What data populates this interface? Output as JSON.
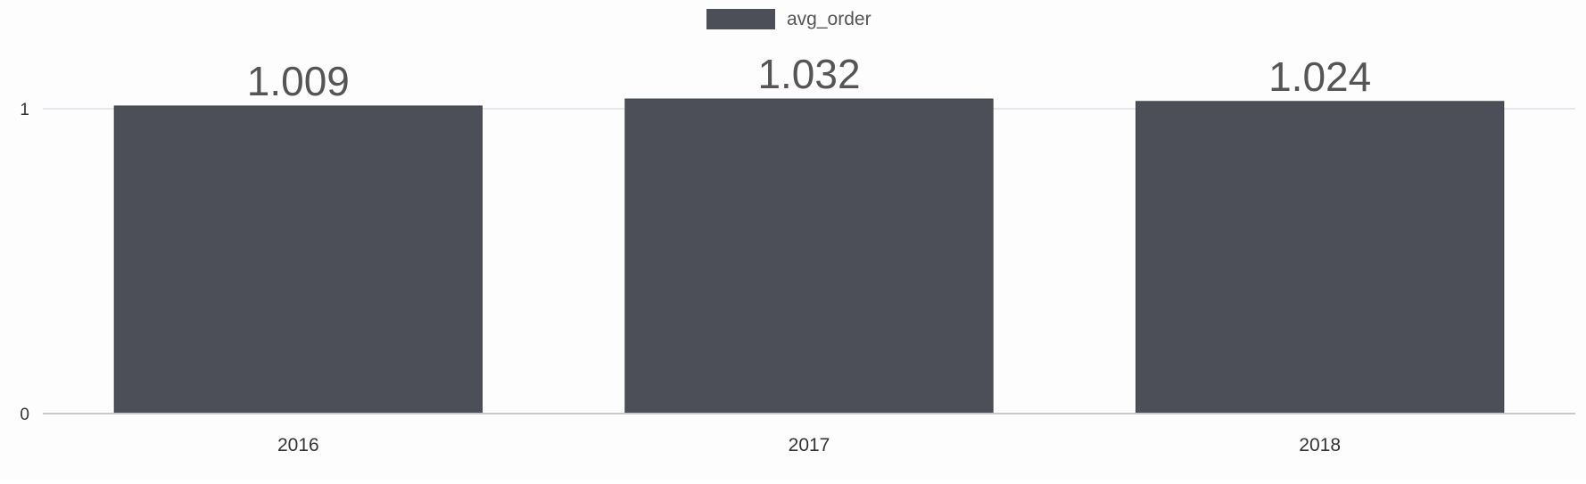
{
  "chart_data": {
    "type": "bar",
    "categories": [
      "2016",
      "2017",
      "2018"
    ],
    "series": [
      {
        "name": "avg_order",
        "values": [
          1.009,
          1.032,
          1.024
        ],
        "color": "#4c4f58"
      }
    ],
    "data_labels": [
      "1.009",
      "1.032",
      "1.024"
    ],
    "y_ticks": [
      "0",
      "1"
    ],
    "ylim": [
      0,
      1
    ],
    "grid": true,
    "legend_position": "top-center",
    "colors": {
      "bar": "#4c4f58",
      "gridline": "#e2e2e6",
      "axis": "#c9c7d4",
      "tick_text": "#333333",
      "data_label": "#555555",
      "legend_text": "#555555"
    }
  }
}
